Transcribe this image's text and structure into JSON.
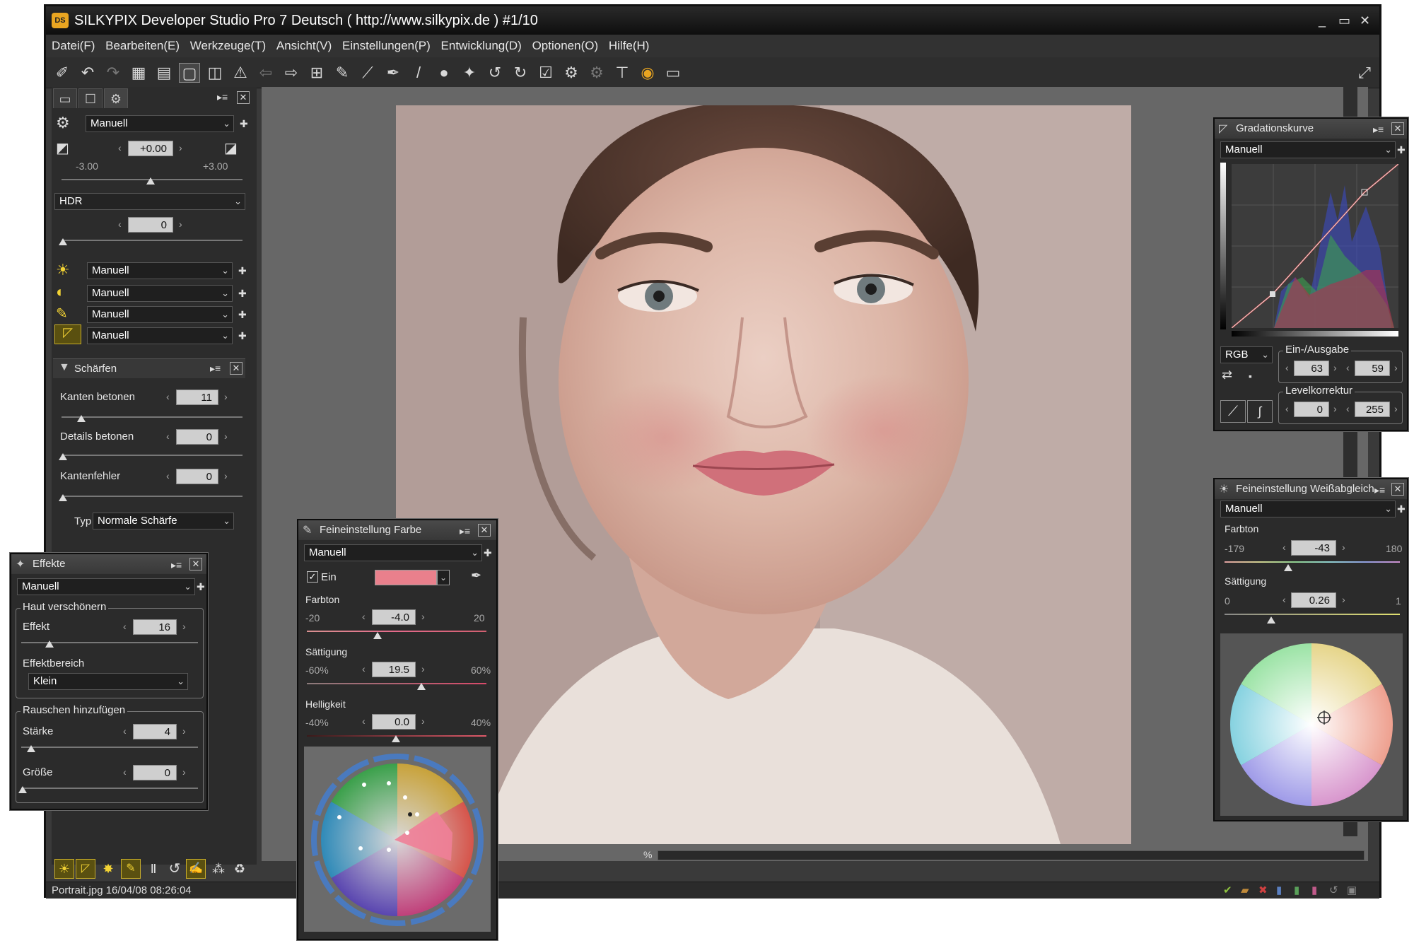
{
  "window": {
    "title": "SILKYPIX Developer Studio Pro 7 Deutsch ( http://www.silkypix.de )   #1/10",
    "app_icon": "DS",
    "controls": [
      "_",
      "▭",
      "✕"
    ]
  },
  "menu": [
    "Datei(F)",
    "Bearbeiten(E)",
    "Werkzeuge(T)",
    "Ansicht(V)",
    "Einstellungen(P)",
    "Entwicklung(D)",
    "Optionen(O)",
    "Hilfe(H)"
  ],
  "left_panel": {
    "preset_select": "Manuell",
    "exposure": {
      "value": "+0.00",
      "min": "-3.00",
      "max": "+3.00"
    },
    "hdr": {
      "select": "HDR",
      "value": "0"
    },
    "tool_selects": [
      "Manuell",
      "Manuell",
      "Manuell",
      "Manuell"
    ],
    "sharpen": {
      "title": "Schärfen",
      "rows": [
        {
          "label": "Kanten betonen",
          "value": "11"
        },
        {
          "label": "Details betonen",
          "value": "0"
        },
        {
          "label": "Kantenfehler",
          "value": "0"
        }
      ],
      "type_label": "Typ",
      "type_value": "Normale Schärfe"
    }
  },
  "effects_window": {
    "title": "Effekte",
    "preset": "Manuell",
    "skin_group": "Haut verschönern",
    "effect_label": "Effekt",
    "effect_value": "16",
    "area_label": "Effektbereich",
    "area_value": "Klein",
    "noise_group": "Rauschen hinzufügen",
    "strength_label": "Stärke",
    "strength_value": "4",
    "size_label": "Größe",
    "size_value": "0"
  },
  "color_window": {
    "title": "Feineinstellung Farbe",
    "preset": "Manuell",
    "enabled_label": "Ein",
    "swatch_color": "#e9808c",
    "hue": {
      "label": "Farbton",
      "min": "-20",
      "max": "20",
      "value": "-4.0"
    },
    "saturation": {
      "label": "Sättigung",
      "min": "-60%",
      "max": "60%",
      "value": "19.5"
    },
    "brightness": {
      "label": "Helligkeit",
      "min": "-40%",
      "max": "40%",
      "value": "0.0"
    }
  },
  "curve_window": {
    "title": "Gradationskurve",
    "preset": "Manuell",
    "channel": "RGB",
    "io_group": "Ein-/Ausgabe",
    "input": "63",
    "output": "59",
    "level_group": "Levelkorrektur",
    "level_low": "0",
    "level_high": "255"
  },
  "wb_window": {
    "title": "Feineinstellung Weißabgleich",
    "preset": "Manuell",
    "hue": {
      "label": "Farbton",
      "min": "-179",
      "max": "180",
      "value": "-43"
    },
    "saturation": {
      "label": "Sättigung",
      "min": "0",
      "max": "1",
      "value": "0.26"
    }
  },
  "status": {
    "file": "Portrait.jpg 16/04/08 08:26:04",
    "zoom_suffix": "%"
  },
  "colors": {
    "window_bg": "#3a3a3a",
    "panel_bg": "#2b2b2b",
    "viewer_bg": "#676767",
    "accent": "#e9a521"
  }
}
